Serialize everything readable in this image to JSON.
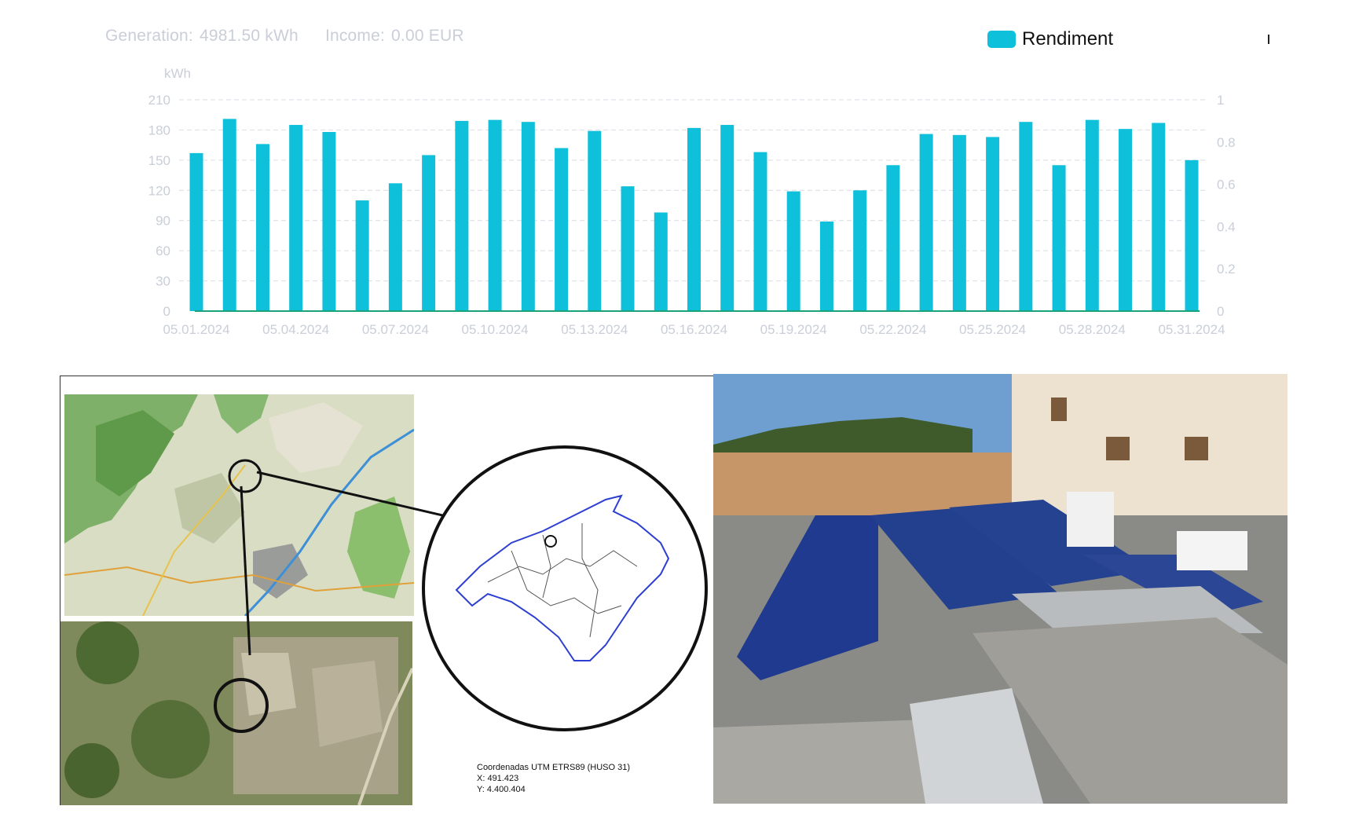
{
  "header": {
    "generation_label": "Generation:",
    "generation_value": "4981.50 kWh",
    "income_label": "Income:",
    "income_value": "0.00 EUR"
  },
  "legend": {
    "label": "Rendiment",
    "color": "#0fc0db"
  },
  "chart_data": {
    "type": "bar",
    "ylabel": "kWh",
    "ylim": [
      0,
      210
    ],
    "yticks": [
      0,
      30,
      60,
      90,
      120,
      150,
      180,
      210
    ],
    "y2lim": [
      0,
      1
    ],
    "y2ticks": [
      "0",
      "0.2",
      "0.4",
      "0.6",
      "0.8",
      "1"
    ],
    "grid": true,
    "legend_position": "top-right",
    "categories": [
      "05.01.2024",
      "05.02.2024",
      "05.03.2024",
      "05.04.2024",
      "05.05.2024",
      "05.06.2024",
      "05.07.2024",
      "05.08.2024",
      "05.09.2024",
      "05.10.2024",
      "05.11.2024",
      "05.12.2024",
      "05.13.2024",
      "05.14.2024",
      "05.15.2024",
      "05.16.2024",
      "05.17.2024",
      "05.18.2024",
      "05.19.2024",
      "05.20.2024",
      "05.21.2024",
      "05.22.2024",
      "05.23.2024",
      "05.24.2024",
      "05.25.2024",
      "05.26.2024",
      "05.27.2024",
      "05.28.2024",
      "05.29.2024",
      "05.30.2024",
      "05.31.2024"
    ],
    "xtick_labels": [
      "05.01.2024",
      "05.04.2024",
      "05.07.2024",
      "05.10.2024",
      "05.13.2024",
      "05.16.2024",
      "05.19.2024",
      "05.22.2024",
      "05.25.2024",
      "05.28.2024",
      "05.31.2024"
    ],
    "series": [
      {
        "name": "Rendiment",
        "color": "#0fc0db",
        "values": [
          157,
          191,
          166,
          185,
          178,
          110,
          127,
          155,
          189,
          190,
          188,
          162,
          179,
          124,
          98,
          182,
          185,
          158,
          119,
          89,
          120,
          145,
          176,
          175,
          173,
          188,
          145,
          190,
          181,
          187,
          150
        ]
      }
    ],
    "baseline_color": "#1aa37a"
  },
  "map_panel": {
    "coords_title": "Coordenadas UTM ETRS89 (HUSO 31)",
    "coords_x": "X: 491.423",
    "coords_y": "Y: 4.400.404"
  }
}
